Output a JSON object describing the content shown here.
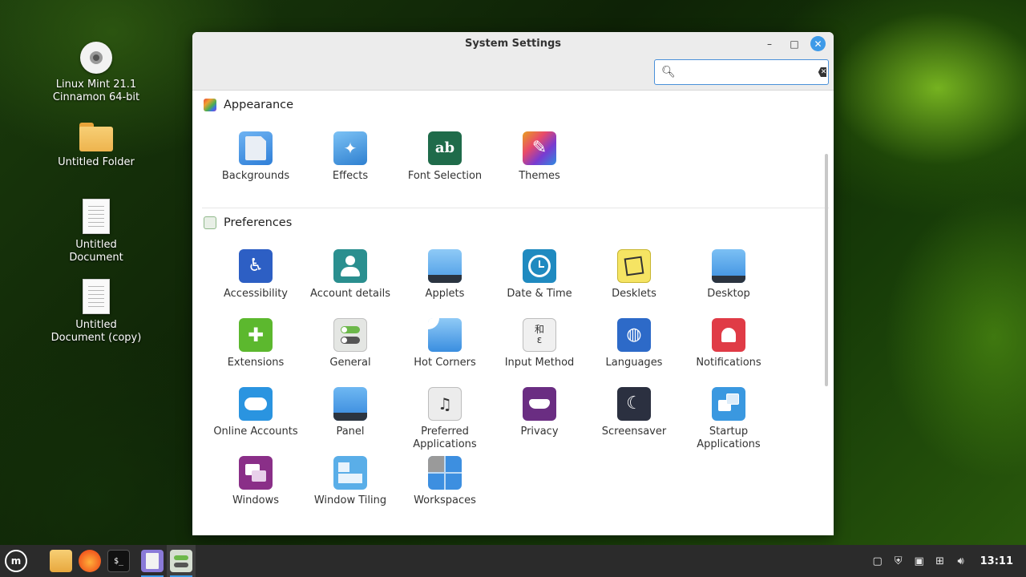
{
  "desktop": {
    "icons": [
      {
        "label": "Linux Mint 21.1\nCinnamon 64-bit",
        "line1": "Linux Mint 21.1",
        "line2": "Cinnamon 64-bit",
        "icon": "disc-icon"
      },
      {
        "line1": "Untitled Folder",
        "line2": "",
        "icon": "folder-icon"
      },
      {
        "line1": "Untitled",
        "line2": "Document",
        "icon": "document-icon"
      },
      {
        "line1": "Untitled",
        "line2": "Document (copy)",
        "icon": "document-icon"
      }
    ]
  },
  "window": {
    "title": "System Settings",
    "minimize_glyph": "–",
    "maximize_glyph": "□",
    "close_glyph": "✕",
    "search": {
      "value": "",
      "placeholder": ""
    }
  },
  "sections": {
    "appearance": {
      "title": "Appearance",
      "items": [
        {
          "label": "Backgrounds",
          "icon": "backgrounds-icon"
        },
        {
          "label": "Effects",
          "icon": "effects-icon"
        },
        {
          "label": "Font Selection",
          "icon": "font-selection-icon"
        },
        {
          "label": "Themes",
          "icon": "themes-icon"
        }
      ]
    },
    "preferences": {
      "title": "Preferences",
      "items": [
        {
          "label": "Accessibility",
          "icon": "accessibility-icon"
        },
        {
          "label": "Account details",
          "icon": "account-details-icon"
        },
        {
          "label": "Applets",
          "icon": "applets-icon"
        },
        {
          "label": "Date & Time",
          "icon": "date-time-icon"
        },
        {
          "label": "Desklets",
          "icon": "desklets-icon"
        },
        {
          "label": "Desktop",
          "icon": "desktop-icon"
        },
        {
          "label": "Extensions",
          "icon": "extensions-icon"
        },
        {
          "label": "General",
          "icon": "general-icon"
        },
        {
          "label": "Hot Corners",
          "icon": "hot-corners-icon"
        },
        {
          "label": "Input Method",
          "icon": "input-method-icon"
        },
        {
          "label": "Languages",
          "icon": "languages-icon"
        },
        {
          "label": "Notifications",
          "icon": "notifications-icon"
        },
        {
          "label": "Online Accounts",
          "icon": "online-accounts-icon"
        },
        {
          "label": "Panel",
          "icon": "panel-icon"
        },
        {
          "label": "Preferred Applications",
          "icon": "preferred-applications-icon"
        },
        {
          "label": "Privacy",
          "icon": "privacy-icon"
        },
        {
          "label": "Screensaver",
          "icon": "screensaver-icon"
        },
        {
          "label": "Startup Applications",
          "icon": "startup-applications-icon"
        },
        {
          "label": "Windows",
          "icon": "windows-icon"
        },
        {
          "label": "Window Tiling",
          "icon": "window-tiling-icon"
        },
        {
          "label": "Workspaces",
          "icon": "workspaces-icon"
        }
      ]
    }
  },
  "taskbar": {
    "apps": [
      {
        "name": "menu",
        "icon": "mint-menu-icon"
      },
      {
        "name": "files",
        "icon": "files-icon"
      },
      {
        "name": "firefox",
        "icon": "firefox-icon"
      },
      {
        "name": "terminal",
        "icon": "terminal-icon",
        "glyph": "$_"
      },
      {
        "name": "text-editor",
        "icon": "text-editor-icon"
      },
      {
        "name": "system-settings",
        "icon": "system-settings-icon"
      }
    ],
    "tray": [
      "clipboard-icon",
      "shield-icon",
      "update-icon",
      "network-icon",
      "volume-icon"
    ],
    "clock": "13:11"
  },
  "colors": {
    "accent": "#3d9ae8",
    "taskbar": "#2b2b2b",
    "window_bg": "#ffffff",
    "titlebar": "#ececec"
  }
}
